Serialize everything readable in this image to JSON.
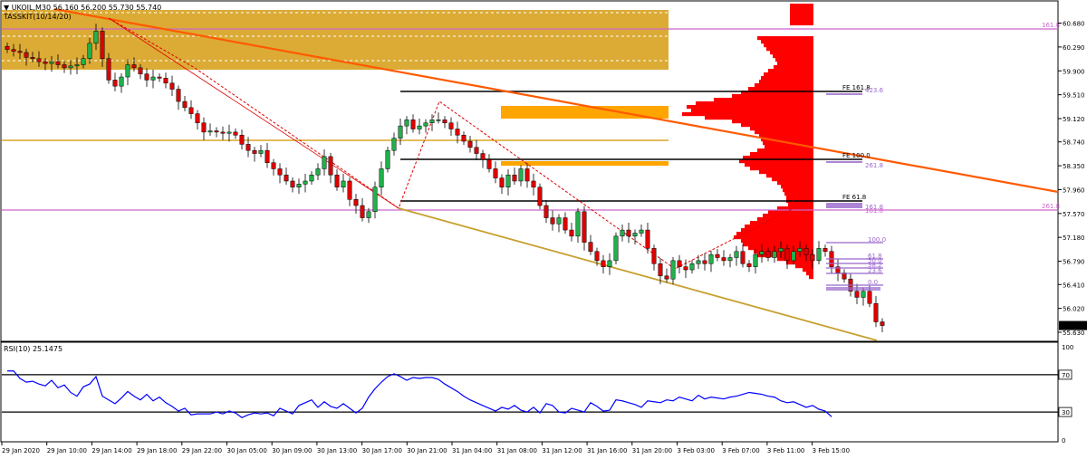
{
  "header": {
    "symbol_line": "UKOIL,M30  56.160 56.200 55.730 55.740",
    "indicator": "TASSKIT(10/14/20)"
  },
  "rsi": {
    "title": "RSI(10) 25.1475"
  },
  "colors": {
    "bull": "#22b14c",
    "bear": "#e00000",
    "zone": "#d9a62a",
    "orange": "#ffa500",
    "trend": "#ff5a00",
    "lowerTrend": "#c8a030",
    "magenta": "#cc66cc",
    "profile": "#ff0000",
    "rsiLine": "#0000ff",
    "fibPurple": "#9966cc"
  },
  "chart_data": [
    {
      "type": "candlestick",
      "ylim": [
        55.63,
        60.88
      ],
      "yticks": [
        "60.680",
        "60.290",
        "59.900",
        "59.510",
        "59.120",
        "58.740",
        "58.350",
        "57.960",
        "57.570",
        "57.180",
        "56.790",
        "56.410",
        "56.020",
        "55.630"
      ],
      "xticks": [
        "29 Jan 2020",
        "29 Jan 10:00",
        "29 Jan 14:00",
        "29 Jan 18:00",
        "29 Jan 22:00",
        "30 Jan 05:00",
        "30 Jan 09:00",
        "30 Jan 13:00",
        "30 Jan 17:00",
        "30 Jan 21:00",
        "31 Jan 04:00",
        "31 Jan 08:00",
        "31 Jan 12:00",
        "31 Jan 16:00",
        "31 Jan 20:00",
        "3 Feb 03:00",
        "3 Feb 07:00",
        "3 Feb 11:00",
        "3 Feb 15:00"
      ],
      "last_price": "55.740",
      "close_path": [
        60.25,
        60.22,
        60.2,
        60.12,
        60.1,
        60.05,
        60.02,
        60.05,
        60.0,
        59.95,
        59.98,
        60.0,
        60.1,
        60.35,
        60.55,
        60.1,
        59.75,
        59.65,
        59.8,
        60.0,
        59.95,
        59.85,
        59.75,
        59.8,
        59.78,
        59.7,
        59.6,
        59.4,
        59.3,
        59.2,
        59.05,
        58.9,
        58.92,
        58.9,
        58.88,
        58.9,
        58.85,
        58.7,
        58.6,
        58.55,
        58.6,
        58.4,
        58.3,
        58.2,
        58.1,
        58.0,
        58.05,
        58.1,
        58.2,
        58.3,
        58.5,
        58.2,
        58.0,
        58.1,
        57.8,
        57.7,
        57.5,
        57.6,
        58.0,
        58.3,
        58.6,
        58.8,
        59.0,
        59.1,
        58.95,
        59.0,
        59.05,
        59.1,
        59.1,
        59.05,
        58.95,
        58.85,
        58.75,
        58.65,
        58.55,
        58.45,
        58.3,
        58.15,
        58.0,
        58.2,
        58.1,
        58.3,
        58.1,
        58.0,
        57.7,
        57.5,
        57.4,
        57.5,
        57.3,
        57.2,
        57.6,
        57.1,
        56.95,
        56.8,
        56.7,
        56.8,
        57.2,
        57.3,
        57.2,
        57.25,
        57.3,
        57.0,
        56.75,
        56.55,
        56.5,
        56.8,
        56.7,
        56.65,
        56.75,
        56.8,
        56.75,
        56.9,
        56.85,
        56.8,
        56.85,
        56.95,
        56.75,
        56.7,
        56.9,
        56.95,
        56.85,
        56.95,
        57.0,
        56.8,
        56.95,
        57.0,
        56.9,
        56.8,
        57.0,
        56.95,
        56.7,
        56.6,
        56.5,
        56.3,
        56.2,
        56.3,
        56.1,
        55.8,
        55.74
      ]
    },
    {
      "type": "line",
      "title": "RSI(10) 25.1475",
      "ylim": [
        0,
        100
      ],
      "levels": [
        70,
        30
      ],
      "yticks": [
        "100",
        "70",
        "30",
        "0"
      ],
      "values": [
        74,
        74,
        66,
        62,
        63,
        60,
        58,
        64,
        56,
        59,
        51,
        47,
        57,
        60,
        68,
        47,
        43,
        39,
        45,
        52,
        47,
        43,
        49,
        42,
        46,
        40,
        36,
        31,
        34,
        27,
        28,
        28,
        28,
        30,
        28,
        31,
        29,
        24,
        27,
        29,
        28,
        29,
        26,
        34,
        31,
        28,
        37,
        40,
        43,
        35,
        41,
        36,
        34,
        39,
        34,
        29,
        34,
        46,
        55,
        62,
        68,
        71,
        68,
        64,
        67,
        66,
        67,
        67,
        65,
        60,
        56,
        52,
        47,
        43,
        40,
        37,
        34,
        31,
        35,
        33,
        37,
        32,
        30,
        35,
        29,
        39,
        37,
        30,
        29,
        34,
        32,
        30,
        40,
        36,
        31,
        32,
        43,
        42,
        40,
        38,
        35,
        42,
        41,
        40,
        43,
        42,
        46,
        44,
        42,
        48,
        44,
        46,
        45,
        44,
        46,
        47,
        49,
        51,
        50,
        49,
        47,
        46,
        42,
        40,
        41,
        38,
        35,
        37,
        33,
        31,
        25
      ]
    }
  ],
  "annotations": {
    "fe_labels": [
      "FE 161.8",
      "FE 100.0",
      "FE 61.8"
    ],
    "fe_purple": [
      "423.6",
      "261.8",
      "161.8"
    ],
    "magenta_label": "161.8",
    "magenta_right_upper": "161.8",
    "magenta_right_lower": "261.8",
    "fib_levels": [
      "100.0",
      "61.8",
      "50.0",
      "38.2",
      "23.6",
      "0.0"
    ]
  }
}
